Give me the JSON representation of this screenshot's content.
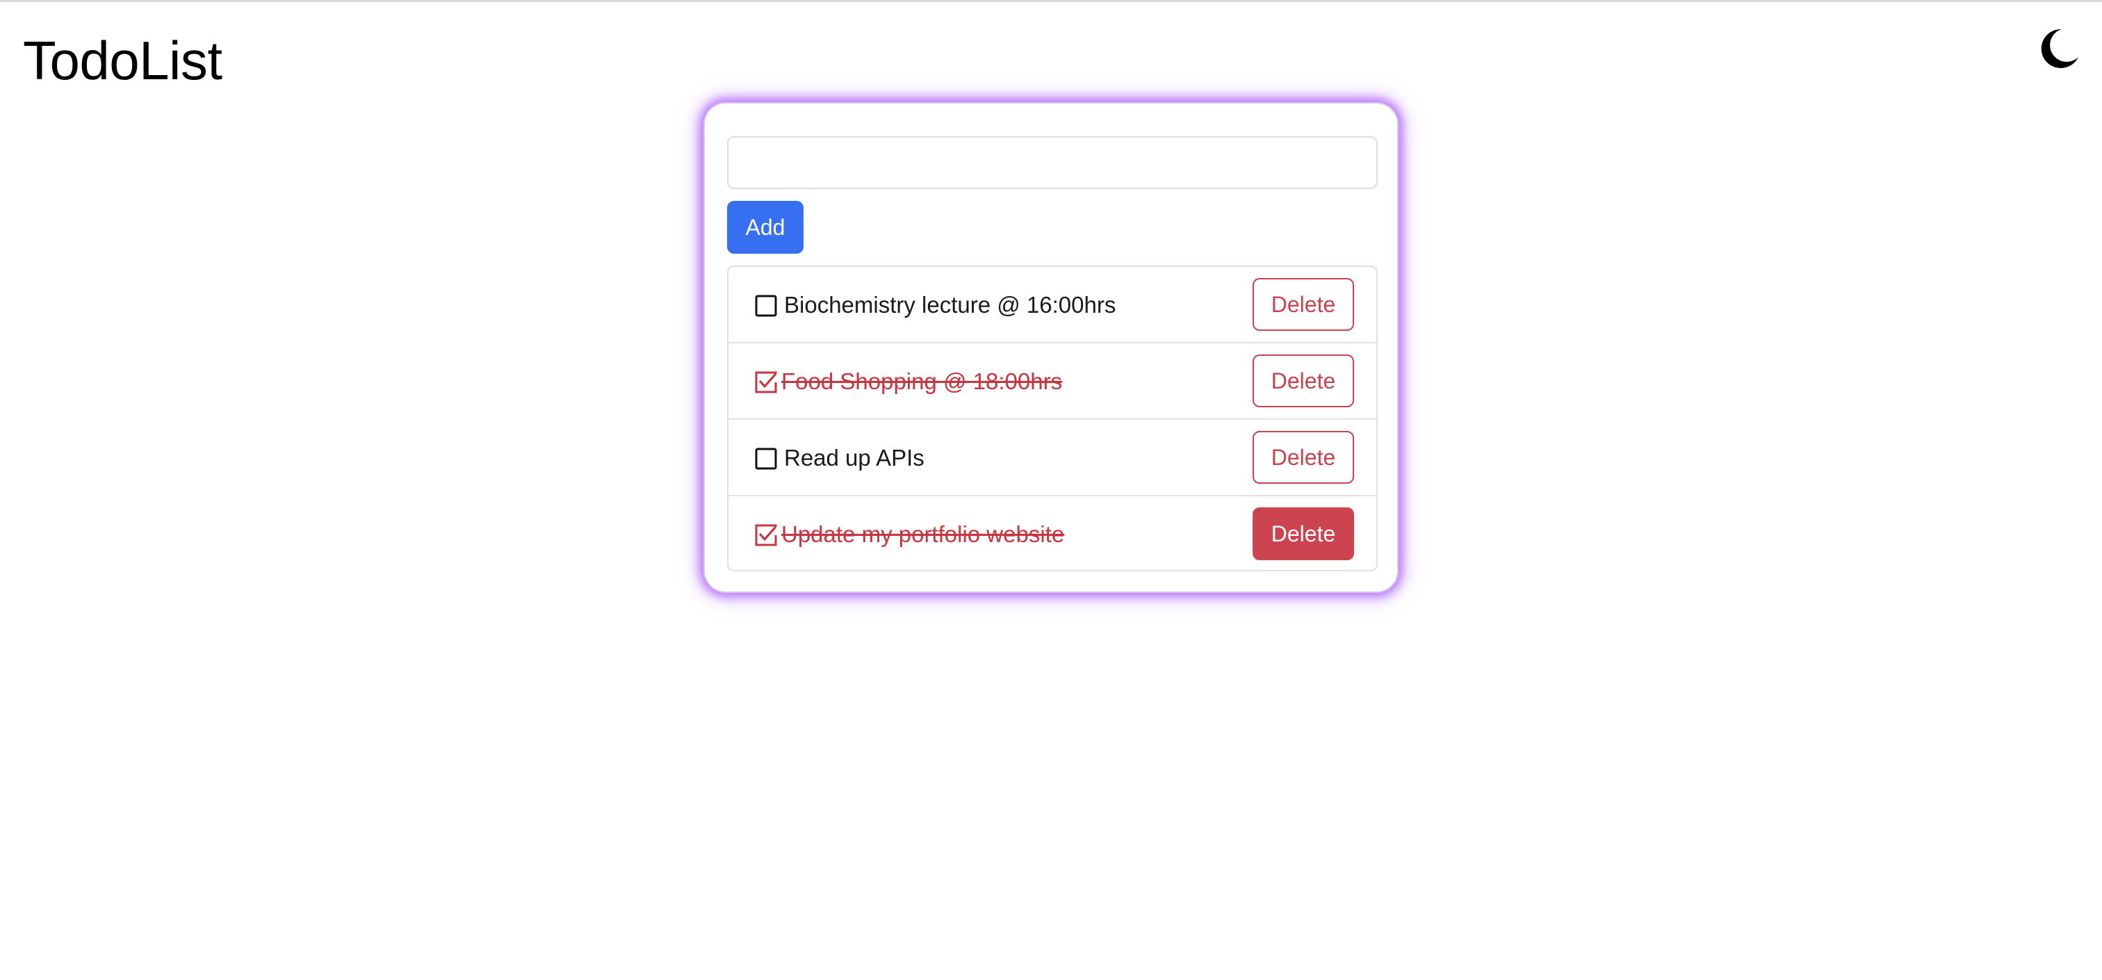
{
  "app": {
    "title": "TodoList",
    "theme_toggle_icon": "moon-icon"
  },
  "colors": {
    "accent": "#3670f0",
    "danger": "#c9424f",
    "card_glow": "#aa5af0"
  },
  "form": {
    "input_value": "",
    "input_placeholder": "",
    "add_label": "Add"
  },
  "todos": [
    {
      "text": "Biochemistry lecture @ 16:00hrs",
      "done": false,
      "delete_label": "Delete"
    },
    {
      "text": "Food Shopping @ 18:00hrs",
      "done": true,
      "delete_label": "Delete"
    },
    {
      "text": "Read up APIs",
      "done": false,
      "delete_label": "Delete"
    },
    {
      "text": "Update my portfolio website",
      "done": true,
      "delete_label": "Delete"
    }
  ]
}
